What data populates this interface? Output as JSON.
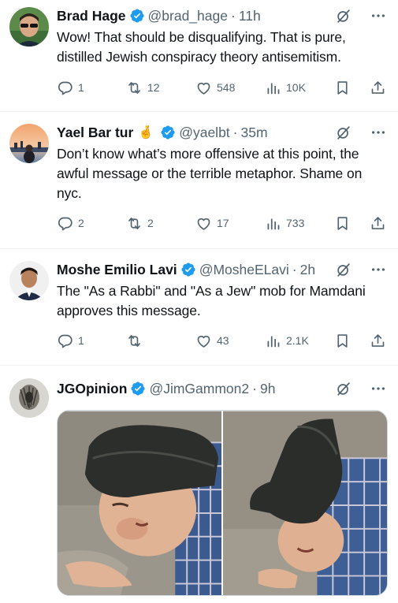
{
  "tweets": [
    {
      "name": "Brad Hage",
      "handle": "@brad_hage",
      "time": "11h",
      "text": "Wow! That should be disqualifying. That is pure, distilled Jewish conspiracy theory antisemitism.",
      "replies": "1",
      "reposts": "12",
      "likes": "548",
      "views": "10K"
    },
    {
      "name": "Yael Bar tur",
      "emoji": "🤞",
      "handle": "@yaelbt",
      "time": "35m",
      "text": "Don’t know what’s more offensive at this point, the awful message or the terrible metaphor. Shame on nyc.",
      "replies": "2",
      "reposts": "2",
      "likes": "17",
      "views": "733"
    },
    {
      "name": "Moshe Emilio Lavi",
      "handle": "@MosheELavi",
      "time": "2h",
      "text": "The \"As a Rabbi\" and \"As a Jew\" mob for Mamdani approves this message.",
      "replies": "1",
      "reposts": "",
      "likes": "43",
      "views": "2.1K"
    },
    {
      "name": "JGOpinion",
      "handle": "@JimGammon2",
      "time": "9h"
    }
  ],
  "colors": {
    "verified": "#1d9bf0",
    "text": "#0f1419",
    "muted": "#536471",
    "divider": "#eff3f4"
  },
  "icons": [
    "verified-badge-icon",
    "grok-icon",
    "more-icon",
    "reply-icon",
    "repost-icon",
    "like-icon",
    "views-icon",
    "bookmark-icon",
    "share-icon"
  ]
}
